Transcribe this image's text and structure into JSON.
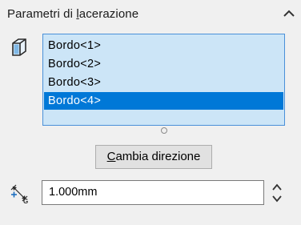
{
  "panel": {
    "title_before": "Parametri di ",
    "title_accel": "l",
    "title_after": "acerazione",
    "collapse_icon": "chevron-up-icon"
  },
  "edges": {
    "icon": "face-selection-icon",
    "items": [
      "Bordo<1>",
      "Bordo<2>",
      "Bordo<3>",
      "Bordo<4>"
    ],
    "selected_index": 3
  },
  "flip_button": {
    "accel": "C",
    "rest": "ambia direzione"
  },
  "distance": {
    "icon": "gap-distance-icon",
    "value": "1.000mm"
  },
  "colors": {
    "list_bg": "#cce5f7",
    "selection": "#0078d7"
  }
}
